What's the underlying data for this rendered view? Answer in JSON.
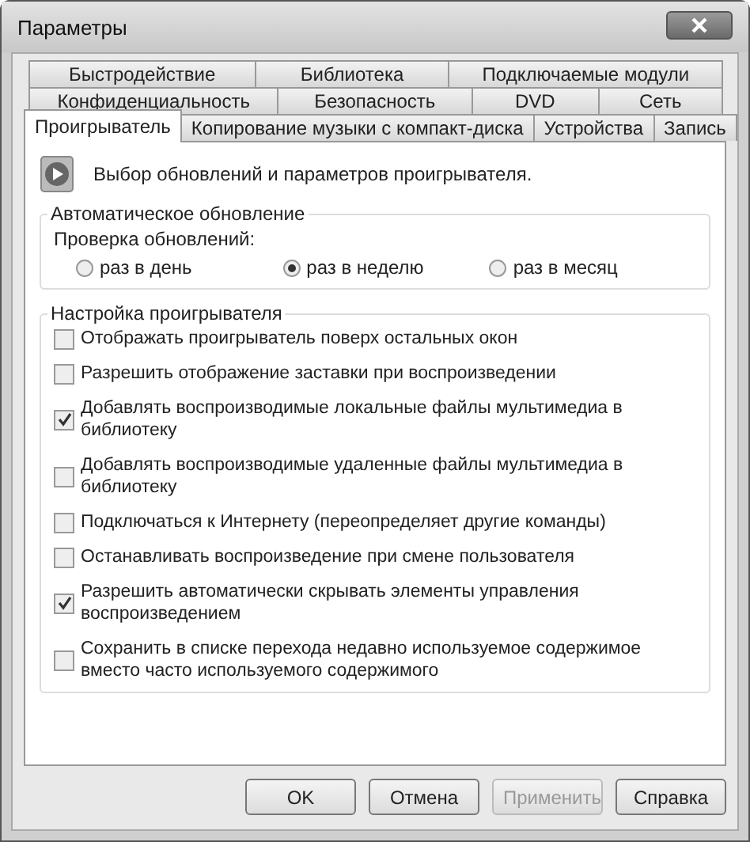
{
  "window": {
    "title": "Параметры"
  },
  "tab_rows": [
    [
      {
        "label": "Быстродействие",
        "selected": false
      },
      {
        "label": "Библиотека",
        "selected": false
      },
      {
        "label": "Подключаемые модули",
        "selected": false
      }
    ],
    [
      {
        "label": "Конфиденциальность",
        "selected": false
      },
      {
        "label": "Безопасность",
        "selected": false
      },
      {
        "label": "DVD",
        "selected": false
      },
      {
        "label": "Сеть",
        "selected": false
      }
    ],
    [
      {
        "label": "Проигрыватель",
        "selected": true
      },
      {
        "label": "Копирование музыки с компакт-диска",
        "selected": false
      },
      {
        "label": "Устройства",
        "selected": false
      },
      {
        "label": "Запись",
        "selected": false
      }
    ]
  ],
  "header": "Выбор обновлений и параметров проигрывателя.",
  "auto_update": {
    "title": "Автоматическое обновление",
    "label": "Проверка обновлений:",
    "options": [
      {
        "label": "раз в день",
        "selected": false
      },
      {
        "label": "раз в неделю",
        "selected": true
      },
      {
        "label": "раз в месяц",
        "selected": false
      }
    ]
  },
  "player_settings": {
    "title": "Настройка проигрывателя",
    "options": [
      {
        "label": "Отображать проигрыватель поверх остальных окон",
        "checked": false
      },
      {
        "label": "Разрешить отображение заставки при воспроизведении",
        "checked": false
      },
      {
        "label": "Добавлять воспроизводимые локальные файлы мультимедиа в библиотеку",
        "checked": true
      },
      {
        "label": "Добавлять воспроизводимые удаленные файлы мультимедиа в библиотеку",
        "checked": false
      },
      {
        "label": "Подключаться к Интернету (переопределяет другие команды)",
        "checked": false
      },
      {
        "label": "Останавливать воспроизведение при смене пользователя",
        "checked": false
      },
      {
        "label": "Разрешить автоматически скрывать элементы управления воспроизведением",
        "checked": true
      },
      {
        "label": "Сохранить в списке перехода недавно используемое содержимое вместо часто используемого содержимого",
        "checked": false
      }
    ]
  },
  "buttons": [
    {
      "label": "OK",
      "disabled": false
    },
    {
      "label": "Отмена",
      "disabled": false
    },
    {
      "label": "Применить",
      "disabled": true
    },
    {
      "label": "Справка",
      "disabled": false
    }
  ]
}
